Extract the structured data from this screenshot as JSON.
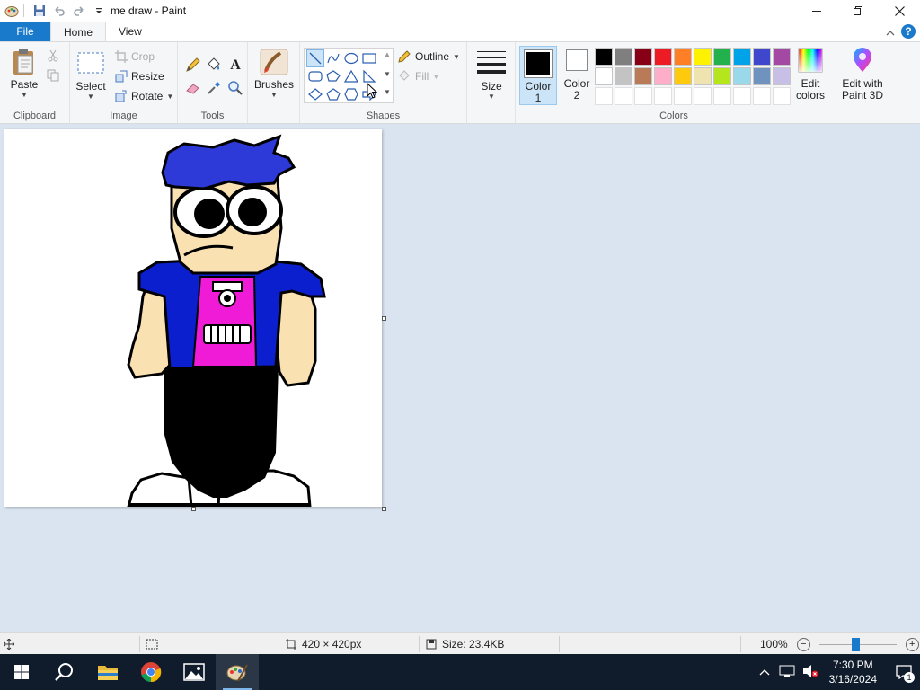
{
  "window": {
    "title": "me draw - Paint"
  },
  "tabs": {
    "file": "File",
    "home": "Home",
    "view": "View"
  },
  "clipboard": {
    "paste": "Paste",
    "label": "Clipboard"
  },
  "image": {
    "select": "Select",
    "crop": "Crop",
    "resize": "Resize",
    "rotate": "Rotate",
    "label": "Image"
  },
  "tools": {
    "label": "Tools"
  },
  "brushes": {
    "label": "Brushes"
  },
  "shapes": {
    "outline": "Outline",
    "fill": "Fill",
    "label": "Shapes"
  },
  "size": {
    "label": "Size"
  },
  "colors": {
    "color1_line1": "Color",
    "color1_line2": "1",
    "color2_line1": "Color",
    "color2_line2": "2",
    "edit_line1": "Edit",
    "edit_line2": "colors",
    "paint3d_line1": "Edit with",
    "paint3d_line2": "Paint 3D",
    "label": "Colors",
    "color1": "#000000",
    "color2": "#ffffff",
    "palette_row1": [
      "#000000",
      "#7f7f7f",
      "#880015",
      "#ed1c24",
      "#ff7f27",
      "#fff200",
      "#22b14c",
      "#00a2e8",
      "#3f48cc",
      "#a349a4"
    ],
    "palette_row2": [
      "#ffffff",
      "#c3c3c3",
      "#b97a57",
      "#ffaec9",
      "#ffc90e",
      "#efe4b0",
      "#b5e61d",
      "#99d9ea",
      "#7092be",
      "#c8bfe7"
    ]
  },
  "status": {
    "dimensions": "420 × 420px",
    "size": "Size: 23.4KB",
    "zoom": "100%"
  },
  "taskbar": {
    "time": "7:30 PM",
    "date": "3/16/2024",
    "notifications": "1"
  }
}
